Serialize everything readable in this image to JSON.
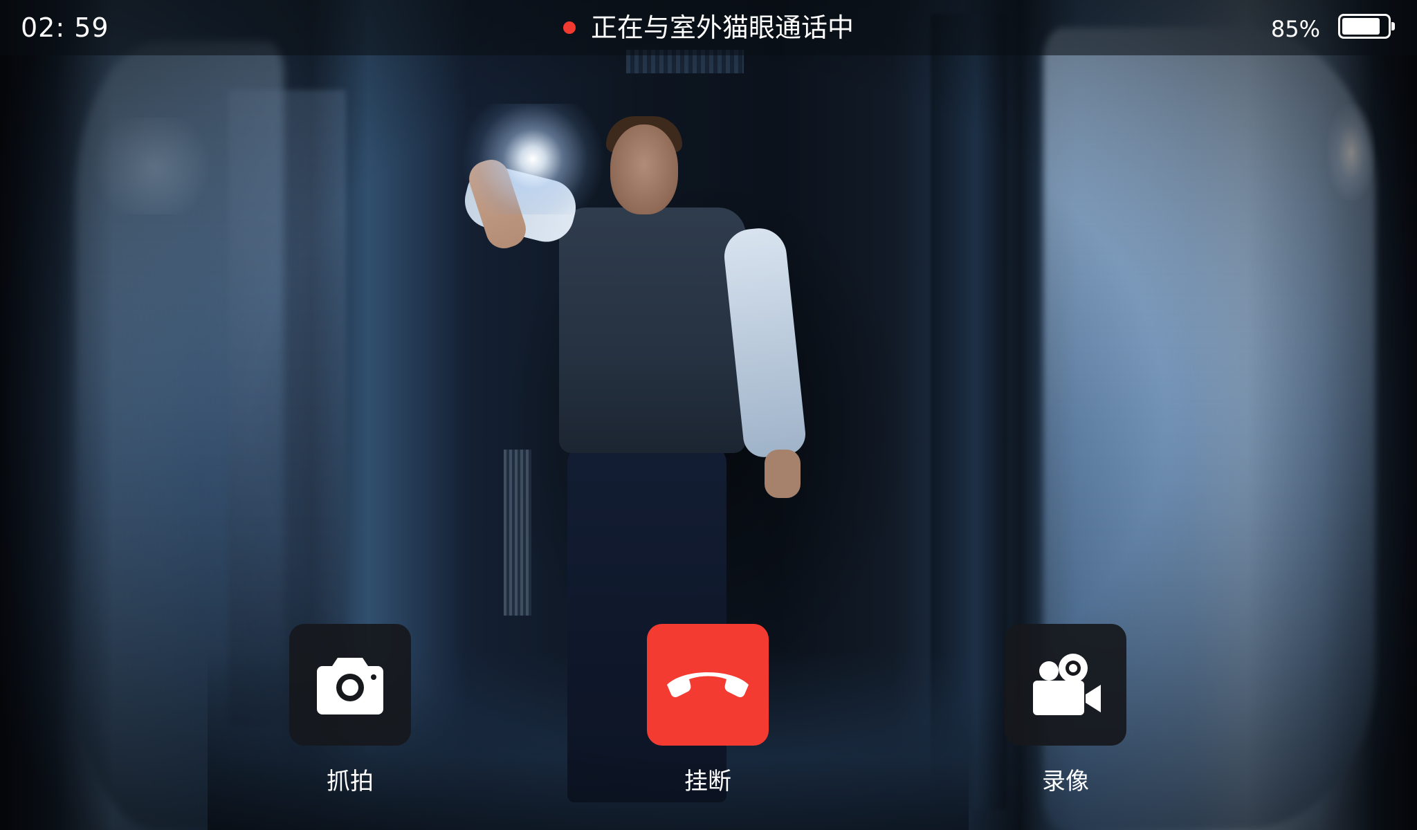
{
  "status_bar": {
    "time": "02: 59",
    "call_status": "正在与室外猫眼通话中",
    "battery_percent": "85%",
    "battery_level": 0.85,
    "recording_indicator_color": "#f23a30"
  },
  "controls": {
    "snapshot": {
      "label": "抓拍",
      "icon": "camera-icon"
    },
    "hangup": {
      "label": "挂断",
      "icon": "phone-hangup-icon",
      "color": "#f43b32"
    },
    "record": {
      "label": "录像",
      "icon": "video-camera-icon"
    }
  }
}
